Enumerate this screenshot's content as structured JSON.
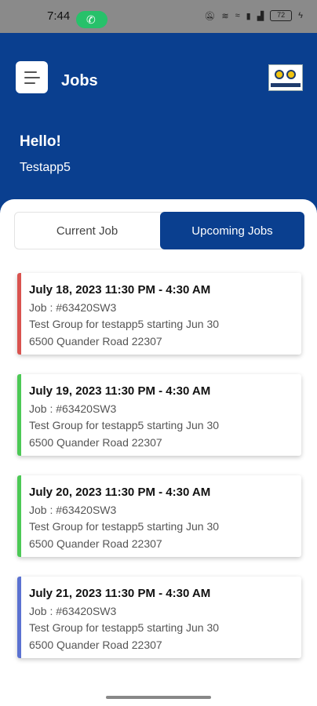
{
  "status_bar": {
    "time": "7:44",
    "battery": "72",
    "icons": [
      "mute-icon",
      "speed-icon",
      "wifi-icon",
      "lte-icon",
      "signal-icon",
      "battery-icon",
      "charging-icon"
    ]
  },
  "header": {
    "title": "Jobs",
    "greeting": "Hello!",
    "username": "Testapp5"
  },
  "tabs": [
    {
      "label": "Current Job",
      "active": false
    },
    {
      "label": "Upcoming Jobs",
      "active": true
    }
  ],
  "jobs": [
    {
      "date": "July 18, 2023 11:30 PM - 4:30 AM",
      "job": "Job : #63420SW3",
      "group": "Test Group for testapp5 starting Jun 30",
      "address": "6500 Quander Road 22307",
      "color": "#d9534f"
    },
    {
      "date": "July 19, 2023 11:30 PM - 4:30 AM",
      "job": "Job : #63420SW3",
      "group": "Test Group for testapp5 starting Jun 30",
      "address": "6500 Quander Road 22307",
      "color": "#4cc955"
    },
    {
      "date": "July 20, 2023 11:30 PM - 4:30 AM",
      "job": "Job : #63420SW3",
      "group": "Test Group for testapp5 starting Jun 30",
      "address": "6500 Quander Road 22307",
      "color": "#4cc955"
    },
    {
      "date": "July 21, 2023 11:30 PM - 4:30 AM",
      "job": "Job : #63420SW3",
      "group": "Test Group for testapp5 starting Jun 30",
      "address": "6500 Quander Road 22307",
      "color": "#5b72d1"
    }
  ],
  "colors": {
    "primary": "#0a3f8f",
    "call_pill": "#27c16a"
  }
}
